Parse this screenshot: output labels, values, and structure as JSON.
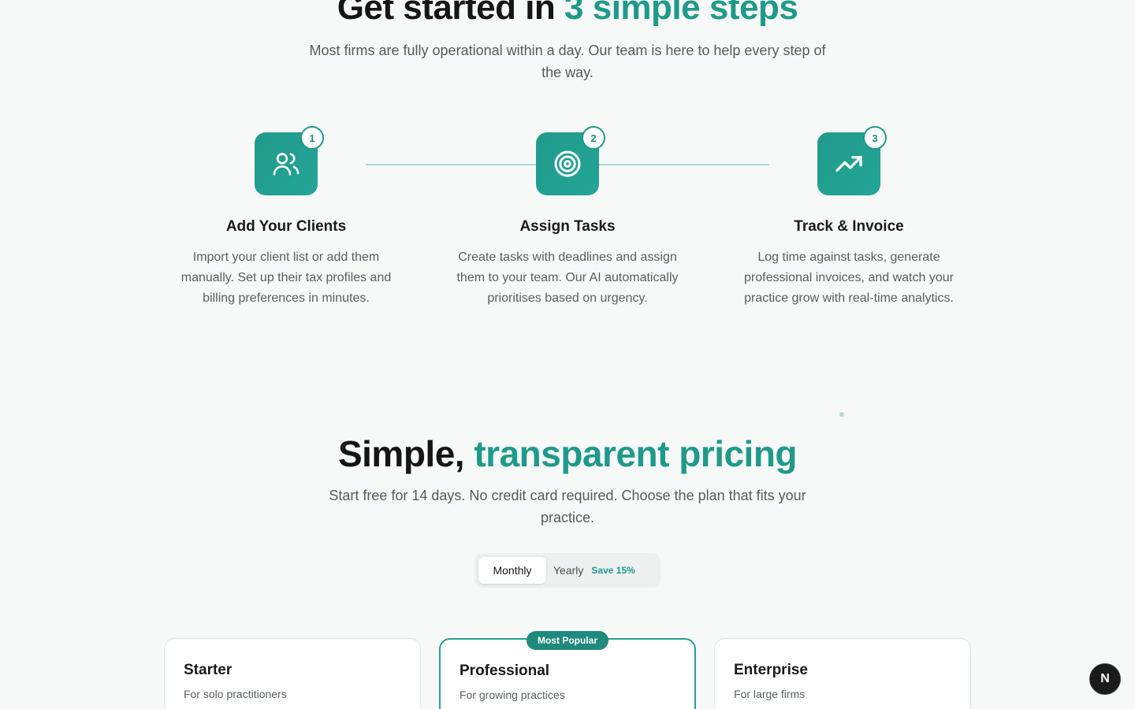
{
  "colors": {
    "accent": "#1f9a8a",
    "background": "#f7f8f8",
    "text": "#151515",
    "muted": "#555b5e"
  },
  "steps_section": {
    "title_prefix": "Get started in ",
    "title_accent": "3 simple steps",
    "subtitle": "Most firms are fully operational within a day. Our team is here to help every step of the way.",
    "steps": [
      {
        "number": "1",
        "icon": "users-icon",
        "title": "Add Your Clients",
        "description": "Import your client list or add them manually. Set up their tax profiles and billing preferences in minutes."
      },
      {
        "number": "2",
        "icon": "target-icon",
        "title": "Assign Tasks",
        "description": "Create tasks with deadlines and assign them to your team. Our AI automatically prioritises based on urgency."
      },
      {
        "number": "3",
        "icon": "trending-up-icon",
        "title": "Track & Invoice",
        "description": "Log time against tasks, generate professional invoices, and watch your practice grow with real-time analytics."
      }
    ]
  },
  "pricing_section": {
    "title_prefix": "Simple, ",
    "title_accent": "transparent pricing",
    "subtitle": "Start free for 14 days. No credit card required. Choose the plan that fits your practice.",
    "toggle": {
      "monthly_label": "Monthly",
      "yearly_label": "Yearly",
      "save_label": "Save 15%",
      "selected": "Monthly"
    },
    "popular_badge": "Most Popular",
    "plans": [
      {
        "name": "Starter",
        "tagline": "For solo practitioners"
      },
      {
        "name": "Professional",
        "tagline": "For growing practices"
      },
      {
        "name": "Enterprise",
        "tagline": "For large firms"
      }
    ]
  },
  "dev_badge": {
    "label": "N",
    "icon": "nextjs-icon"
  }
}
